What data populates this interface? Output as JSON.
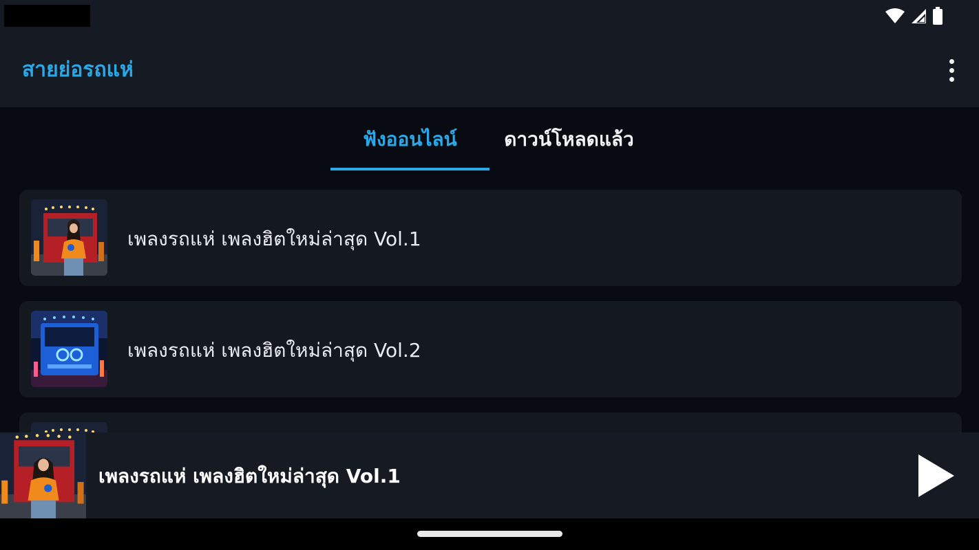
{
  "status_bar": {
    "icons": [
      "wifi-icon",
      "cellular-signal-icon",
      "battery-icon"
    ]
  },
  "app_bar": {
    "title": "สายย่อรถแห่",
    "menu_icon": "more-vert-icon"
  },
  "tabs": [
    {
      "label": "ฟังออนไลน์",
      "selected": true
    },
    {
      "label": "ดาวน์โหลดแล้ว",
      "selected": false
    }
  ],
  "tracks": [
    {
      "title": "เพลงรถแห่ เพลงฮิตใหม่ล่าสุด Vol.1",
      "thumbnail": "red-truck-singer-thumbnail"
    },
    {
      "title": "เพลงรถแห่ เพลงฮิตใหม่ล่าสุด Vol.2",
      "thumbnail": "blue-truck-thumbnail"
    },
    {
      "title": "",
      "thumbnail": "red-truck-thumbnail"
    }
  ],
  "now_playing": {
    "title": "เพลงรถแห่ เพลงฮิตใหม่ล่าสุด Vol.1",
    "thumbnail": "red-truck-singer-thumbnail",
    "control_icon": "play-icon"
  },
  "colors": {
    "accent": "#2aa8e8",
    "background": "#080c12",
    "surface": "#151a23",
    "card": "#141920"
  }
}
